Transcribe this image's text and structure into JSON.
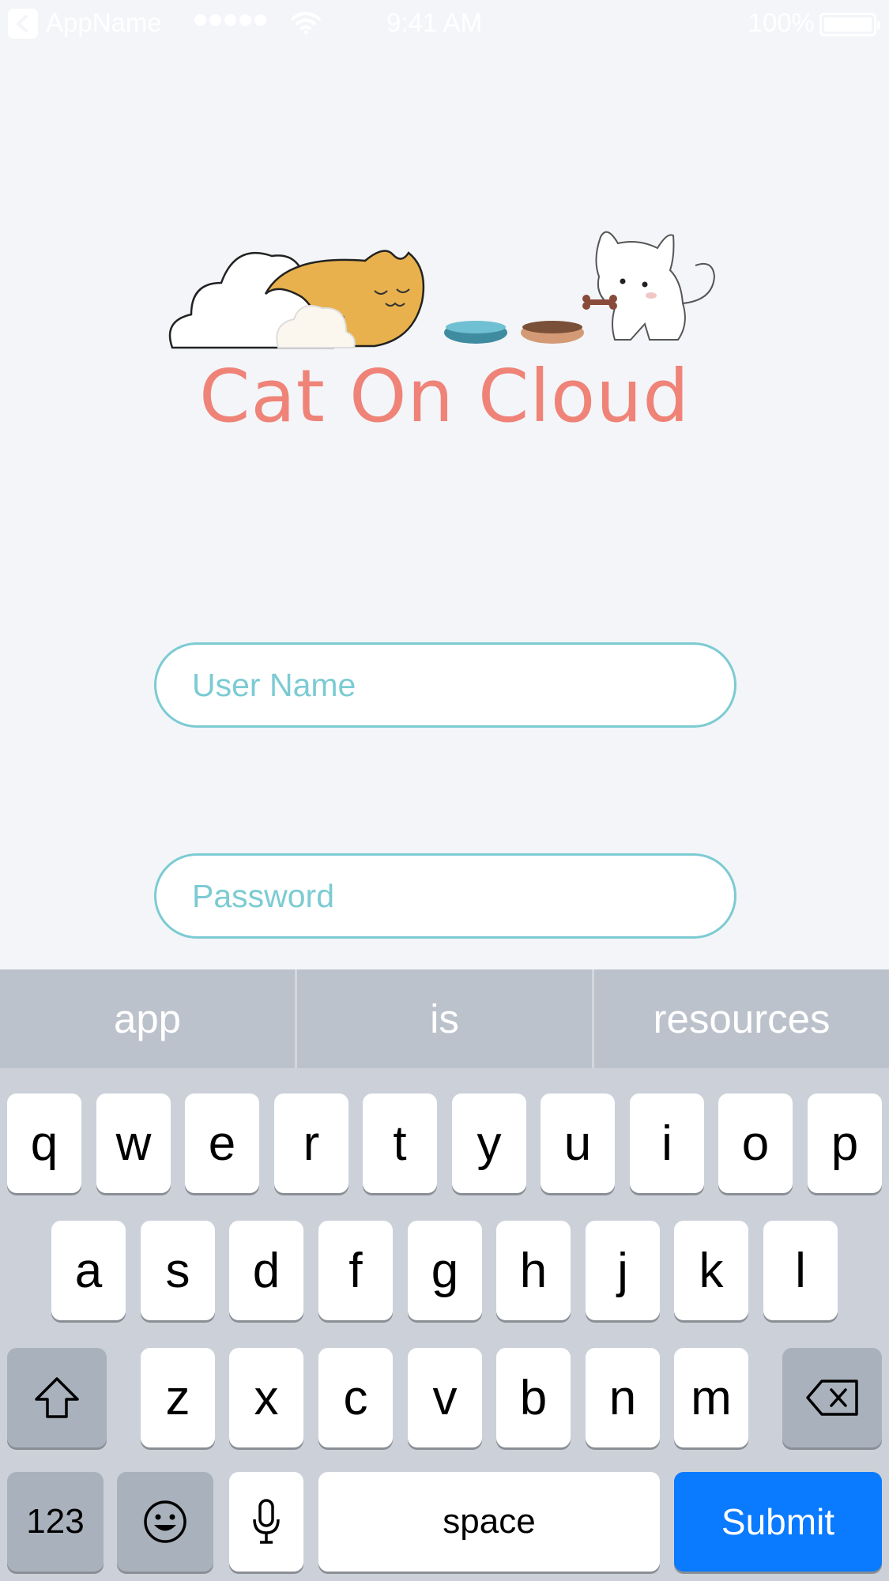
{
  "status_bar": {
    "back_app": "AppName",
    "time": "9:41 AM",
    "battery": "100%"
  },
  "logo": {
    "title": "Cat On Cloud",
    "image": "cat-on-cloud-illustration"
  },
  "form": {
    "username_placeholder": "User Name",
    "password_placeholder": "Password"
  },
  "keyboard": {
    "suggestions": [
      "app",
      "is",
      "resources"
    ],
    "row1": [
      "q",
      "w",
      "e",
      "r",
      "t",
      "y",
      "u",
      "i",
      "o",
      "p"
    ],
    "row2": [
      "a",
      "s",
      "d",
      "f",
      "g",
      "h",
      "j",
      "k",
      "l"
    ],
    "row3": [
      "z",
      "x",
      "c",
      "v",
      "b",
      "n",
      "m"
    ],
    "numbers_label": "123",
    "space_label": "space",
    "submit_label": "Submit"
  },
  "colors": {
    "accent_title": "#ef8378",
    "field_border": "#7ccbd3",
    "submit": "#0a7aff"
  }
}
